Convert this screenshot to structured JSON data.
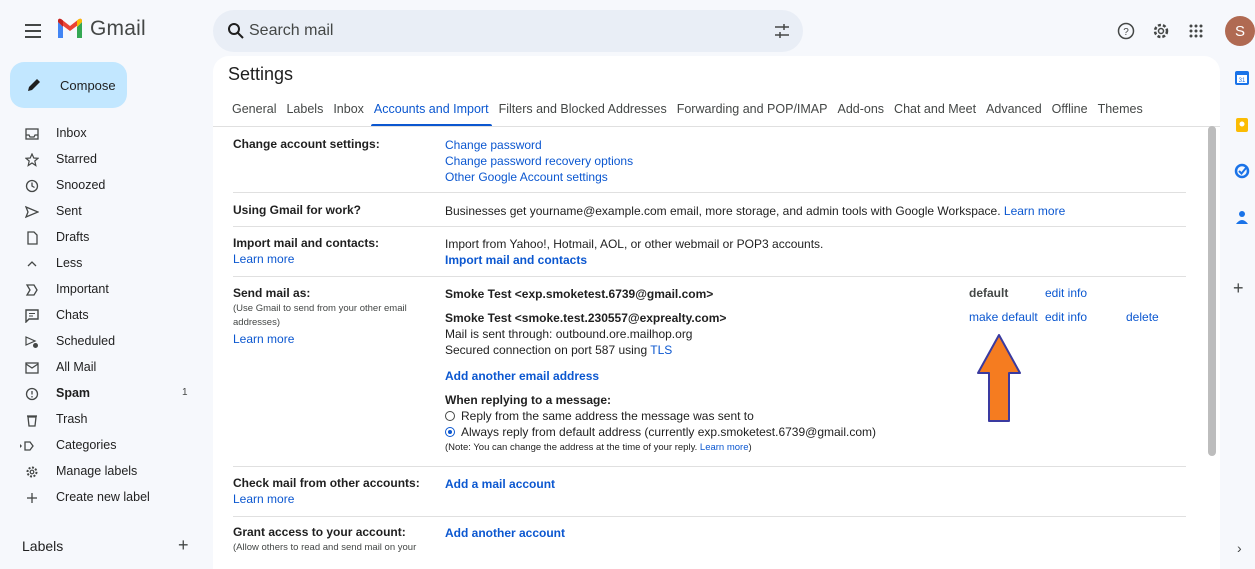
{
  "app": {
    "name": "Gmail",
    "avatar_letter": "S"
  },
  "search": {
    "placeholder": "Search mail"
  },
  "compose": {
    "label": "Compose"
  },
  "nav": [
    {
      "label": "Inbox",
      "icon": "inbox-icon"
    },
    {
      "label": "Starred",
      "icon": "star-icon"
    },
    {
      "label": "Snoozed",
      "icon": "clock-icon"
    },
    {
      "label": "Sent",
      "icon": "send-icon"
    },
    {
      "label": "Drafts",
      "icon": "draft-icon"
    },
    {
      "label": "Less",
      "icon": "chevron-up-icon"
    },
    {
      "label": "Important",
      "icon": "important-icon"
    },
    {
      "label": "Chats",
      "icon": "chat-icon"
    },
    {
      "label": "Scheduled",
      "icon": "scheduled-icon"
    },
    {
      "label": "All Mail",
      "icon": "all-mail-icon"
    },
    {
      "label": "Spam",
      "icon": "spam-icon",
      "count": "1"
    },
    {
      "label": "Trash",
      "icon": "trash-icon"
    },
    {
      "label": "Categories",
      "icon": "label-icon"
    },
    {
      "label": "Manage labels",
      "icon": "gear-icon"
    },
    {
      "label": "Create new label",
      "icon": "plus-icon"
    }
  ],
  "labels_header": "Labels",
  "settings": {
    "title": "Settings",
    "tabs": [
      "General",
      "Labels",
      "Inbox",
      "Accounts and Import",
      "Filters and Blocked Addresses",
      "Forwarding and POP/IMAP",
      "Add-ons",
      "Chat and Meet",
      "Advanced",
      "Offline",
      "Themes"
    ],
    "active_tab": "Accounts and Import",
    "change_account": {
      "label": "Change account settings:",
      "links": [
        "Change password",
        "Change password recovery options",
        "Other Google Account settings"
      ]
    },
    "work": {
      "label": "Using Gmail for work?",
      "text": "Businesses get yourname@example.com email, more storage, and admin tools with Google Workspace.",
      "link": "Learn more"
    },
    "import": {
      "label": "Import mail and contacts:",
      "learn_more": "Learn more",
      "text": "Import from Yahoo!, Hotmail, AOL, or other webmail or POP3 accounts.",
      "action": "Import mail and contacts"
    },
    "send_as": {
      "label": "Send mail as:",
      "sub": "(Use Gmail to send from your other email addresses)",
      "learn_more": "Learn more",
      "primary": "Smoke Test <exp.smoketest.6739@gmail.com>",
      "primary_status": "default",
      "primary_edit": "edit info",
      "secondary": "Smoke Test <smoke.test.230557@exprealty.com>",
      "secondary_line2": "Mail is sent through: outbound.ore.mailhop.org",
      "secondary_line3_prefix": "Secured connection on port 587 using",
      "secondary_tls": "TLS",
      "make_default": "make default",
      "secondary_edit": "edit info",
      "delete": "delete",
      "add_another": "Add another email address",
      "reply_heading": "When replying to a message:",
      "reply_option1": "Reply from the same address the message was sent to",
      "reply_option2": "Always reply from default address (currently exp.smoketest.6739@gmail.com)",
      "reply_note": "(Note: You can change the address at the time of your reply.",
      "reply_note_link": "Learn more",
      "reply_note_end": ")"
    },
    "check_mail": {
      "label": "Check mail from other accounts:",
      "learn_more": "Learn more",
      "action": "Add a mail account"
    },
    "grant": {
      "label": "Grant access to your account:",
      "sub": "(Allow others to read and send mail on your",
      "action": "Add another account"
    }
  },
  "colors": {
    "accent": "#0b57d0",
    "arrow_fill": "#f57c20",
    "arrow_stroke": "#3a3aa0"
  }
}
